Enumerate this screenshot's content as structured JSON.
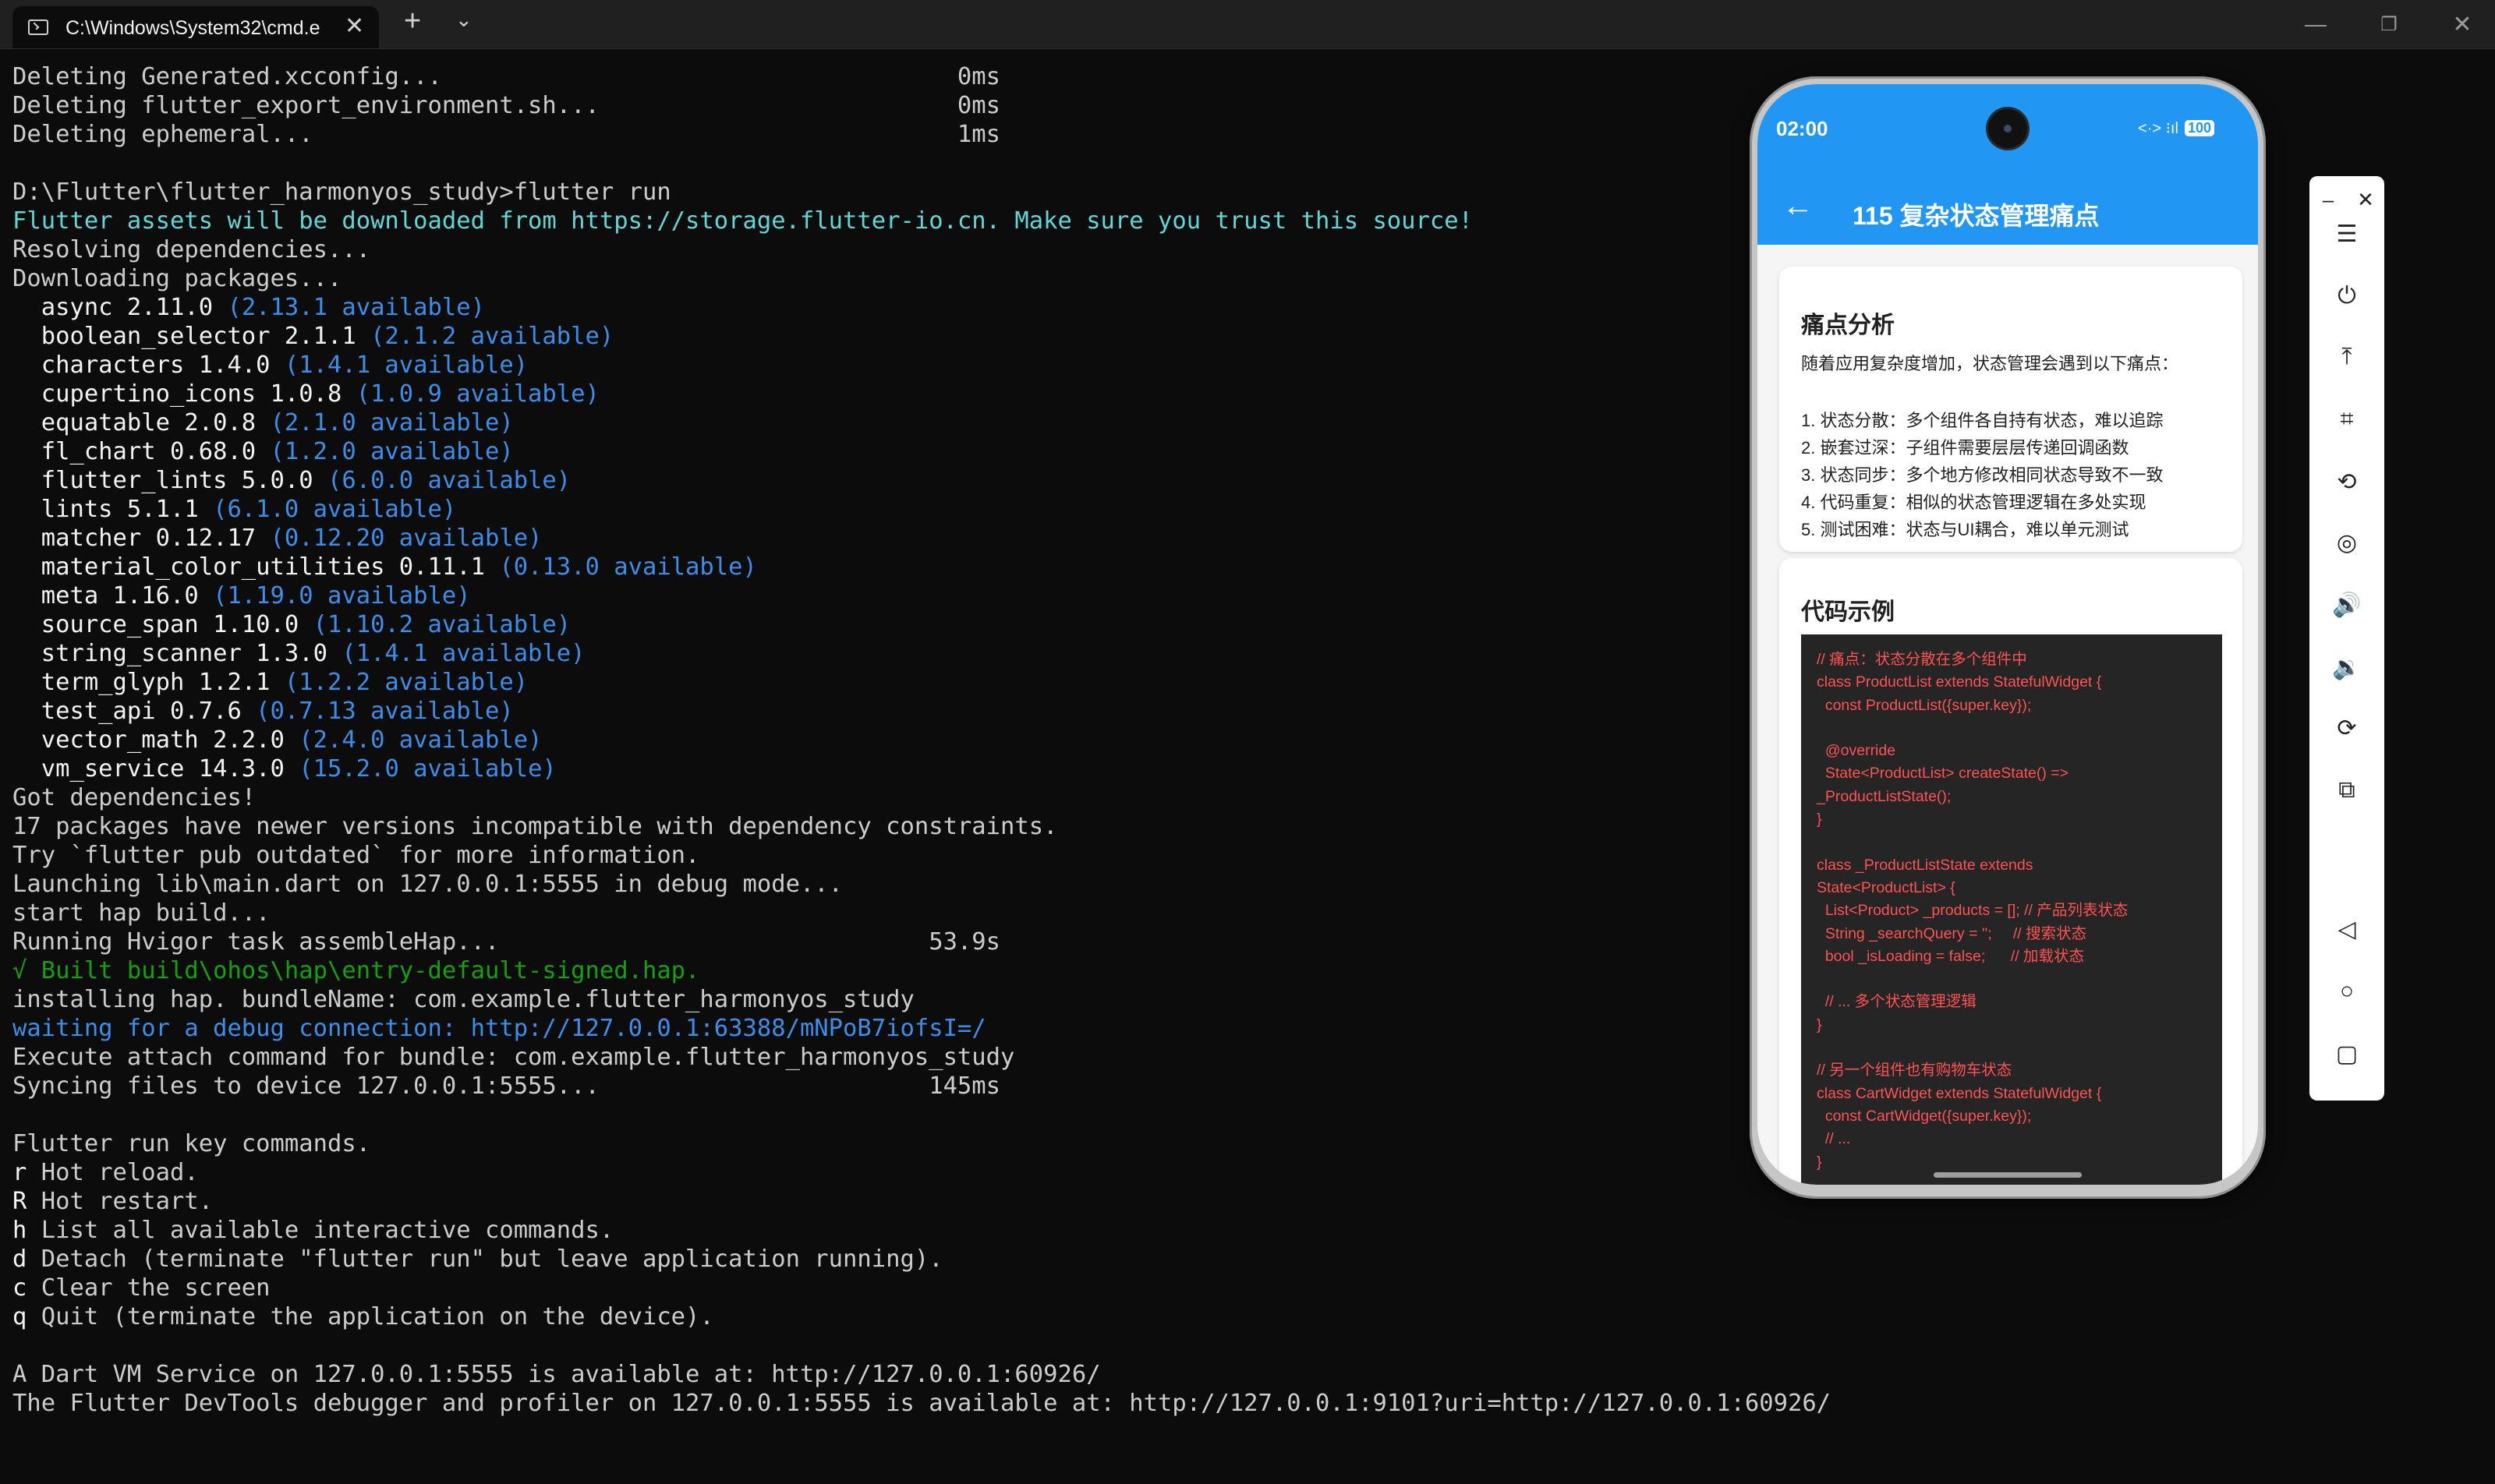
{
  "window": {
    "tab_title": "C:\\Windows\\System32\\cmd.e",
    "tab_icon": "terminal-icon",
    "close_tab_glyph": "✕",
    "new_tab_glyph": "+",
    "dropdown_glyph": "⌄",
    "minimize_glyph": "—",
    "maximize_glyph": "❐",
    "close_glyph": "✕"
  },
  "terminal": {
    "lines": [
      {
        "text": "Deleting Generated.xcconfig...                                    0ms",
        "color": "default"
      },
      {
        "text": "Deleting flutter_export_environment.sh...                         0ms",
        "color": "default"
      },
      {
        "text": "Deleting ephemeral...                                             1ms",
        "color": "default"
      },
      {
        "text": "",
        "color": "default"
      },
      {
        "text": "D:\\Flutter\\flutter_harmonyos_study>flutter run",
        "color": "default"
      },
      {
        "text": "Flutter assets will be downloaded from https://storage.flutter-io.cn. Make sure you trust this source!",
        "color": "cyan"
      },
      {
        "text": "Resolving dependencies...",
        "color": "default"
      },
      {
        "text": "Downloading packages...",
        "color": "default"
      },
      {
        "text": "  async 2.11.0 ",
        "color": "bright",
        "note": "(2.13.1 available)"
      },
      {
        "text": "  boolean_selector 2.1.1 ",
        "color": "bright",
        "note": "(2.1.2 available)"
      },
      {
        "text": "  characters 1.4.0 ",
        "color": "bright",
        "note": "(1.4.1 available)"
      },
      {
        "text": "  cupertino_icons 1.0.8 ",
        "color": "bright",
        "note": "(1.0.9 available)"
      },
      {
        "text": "  equatable 2.0.8 ",
        "color": "bright",
        "note": "(2.1.0 available)"
      },
      {
        "text": "  fl_chart 0.68.0 ",
        "color": "bright",
        "note": "(1.2.0 available)"
      },
      {
        "text": "  flutter_lints 5.0.0 ",
        "color": "bright",
        "note": "(6.0.0 available)"
      },
      {
        "text": "  lints 5.1.1 ",
        "color": "bright",
        "note": "(6.1.0 available)"
      },
      {
        "text": "  matcher 0.12.17 ",
        "color": "bright",
        "note": "(0.12.20 available)"
      },
      {
        "text": "  material_color_utilities 0.11.1 ",
        "color": "bright",
        "note": "(0.13.0 available)"
      },
      {
        "text": "  meta 1.16.0 ",
        "color": "bright",
        "note": "(1.19.0 available)"
      },
      {
        "text": "  source_span 1.10.0 ",
        "color": "bright",
        "note": "(1.10.2 available)"
      },
      {
        "text": "  string_scanner 1.3.0 ",
        "color": "bright",
        "note": "(1.4.1 available)"
      },
      {
        "text": "  term_glyph 1.2.1 ",
        "color": "bright",
        "note": "(1.2.2 available)"
      },
      {
        "text": "  test_api 0.7.6 ",
        "color": "bright",
        "note": "(0.7.13 available)"
      },
      {
        "text": "  vector_math 2.2.0 ",
        "color": "bright",
        "note": "(2.4.0 available)"
      },
      {
        "text": "  vm_service 14.3.0 ",
        "color": "bright",
        "note": "(15.2.0 available)"
      },
      {
        "text": "Got dependencies!",
        "color": "default"
      },
      {
        "text": "17 packages have newer versions incompatible with dependency constraints.",
        "color": "default"
      },
      {
        "text": "Try `flutter pub outdated` for more information.",
        "color": "default"
      },
      {
        "text": "Launching lib\\main.dart on 127.0.0.1:5555 in debug mode...",
        "color": "default"
      },
      {
        "text": "start hap build...",
        "color": "default"
      },
      {
        "text": "Running Hvigor task assembleHap...                              53.9s",
        "color": "default"
      },
      {
        "text": "√ Built build\\ohos\\hap\\entry-default-signed.hap.",
        "color": "green"
      },
      {
        "text": "installing hap. bundleName: com.example.flutter_harmonyos_study",
        "color": "default"
      },
      {
        "text": "waiting for a debug connection: http://127.0.0.1:63388/mNPoB7iofsI=/",
        "color": "blue"
      },
      {
        "text": "Execute attach command for bundle: com.example.flutter_harmonyos_study",
        "color": "default"
      },
      {
        "text": "Syncing files to device 127.0.0.1:5555...                       145ms",
        "color": "default"
      },
      {
        "text": "",
        "color": "default"
      },
      {
        "text": "Flutter run key commands.",
        "color": "default"
      },
      {
        "text": "Hot reload.",
        "color": "default",
        "key": "r"
      },
      {
        "text": "Hot restart.",
        "color": "default",
        "key": "R"
      },
      {
        "text": "List all available interactive commands.",
        "color": "default",
        "key": "h"
      },
      {
        "text": "Detach (terminate \"flutter run\" but leave application running).",
        "color": "default",
        "key": "d"
      },
      {
        "text": "Clear the screen",
        "color": "default",
        "key": "c"
      },
      {
        "text": "Quit (terminate the application on the device).",
        "color": "default",
        "key": "q"
      },
      {
        "text": "",
        "color": "default"
      },
      {
        "text": "A Dart VM Service on 127.0.0.1:5555 is available at: http://127.0.0.1:60926/",
        "color": "default"
      },
      {
        "text": "The Flutter DevTools debugger and profiler on 127.0.0.1:5555 is available at: http://127.0.0.1:9101?uri=http://127.0.0.1:60926/",
        "color": "default"
      }
    ]
  },
  "phone": {
    "status": {
      "time": "02:00",
      "icons": "<·> ⁝ıl",
      "battery": "100"
    },
    "appbar": {
      "back_glyph": "←",
      "title": "115 复杂状态管理痛点"
    },
    "card1": {
      "title": "痛点分析",
      "intro": "随着应用复杂度增加，状态管理会遇到以下痛点：",
      "items": [
        "1. 状态分散：多个组件各自持有状态，难以追踪",
        "2. 嵌套过深：子组件需要层层传递回调函数",
        "3. 状态同步：多个地方修改相同状态导致不一致",
        "4. 代码重复：相似的状态管理逻辑在多处实现",
        "5. 测试困难：状态与UI耦合，难以单元测试"
      ]
    },
    "card2": {
      "title": "代码示例",
      "code": "// 痛点：状态分散在多个组件中\nclass ProductList extends StatefulWidget {\n  const ProductList({super.key});\n\n  @override\n  State<ProductList> createState() =>\n_ProductListState();\n}\n\nclass _ProductListState extends\nState<ProductList> {\n  List<Product> _products = []; // 产品列表状态\n  String _searchQuery = '';     // 搜索状态\n  bool _isLoading = false;      // 加载状态\n\n  // ... 多个状态管理逻辑\n}\n\n// 另一个组件也有购物车状态\nclass CartWidget extends StatefulWidget {\n  const CartWidget({super.key});\n  // ...\n}"
    }
  },
  "toolbar": {
    "buttons": [
      {
        "name": "menu-icon",
        "glyph": "☰"
      },
      {
        "name": "power-icon",
        "glyph": "⏻"
      },
      {
        "name": "pin-top-icon",
        "glyph": "⤒"
      },
      {
        "name": "crop-icon",
        "glyph": "⌗"
      },
      {
        "name": "rotate-icon",
        "glyph": "⟲"
      },
      {
        "name": "record-icon",
        "glyph": "◎"
      },
      {
        "name": "volume-up-icon",
        "glyph": "🔊"
      },
      {
        "name": "volume-down-icon",
        "glyph": "🔉"
      },
      {
        "name": "rotate-device-icon",
        "glyph": "⟳"
      },
      {
        "name": "multi-device-icon",
        "glyph": "⧉"
      },
      {
        "name": "back-icon",
        "glyph": "◁"
      },
      {
        "name": "home-icon",
        "glyph": "○"
      },
      {
        "name": "recents-icon",
        "glyph": "▢"
      }
    ],
    "minimize_glyph": "–",
    "close_glyph": "✕"
  },
  "colors": {
    "terminal_bg": "#0c0c0c",
    "terminal_text": "#cccccc",
    "cyan": "#61d6d6",
    "blue": "#3b8eea",
    "green": "#13a10e",
    "appbar": "#2196f3",
    "code_text": "#ff5252"
  }
}
